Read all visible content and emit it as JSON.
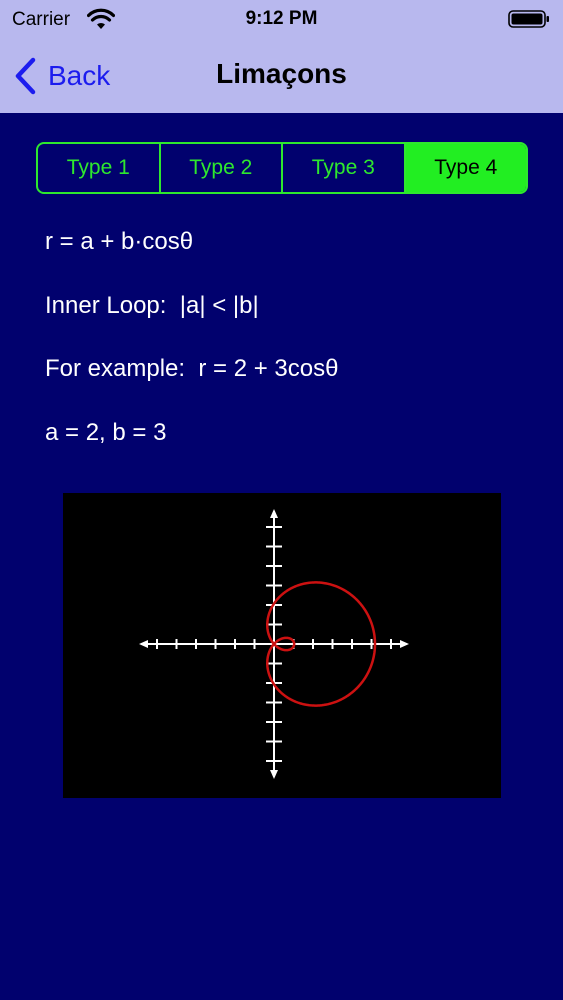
{
  "status_bar": {
    "carrier": "Carrier",
    "time": "9:12 PM"
  },
  "nav": {
    "back_label": "Back",
    "title": "Limaçons"
  },
  "segments": {
    "items": [
      "Type 1",
      "Type 2",
      "Type 3",
      "Type 4"
    ],
    "selected_index": 3
  },
  "content": {
    "formula": "r = a + b·cosθ",
    "condition": "Inner Loop:  |a| < |b|",
    "example": "For example:  r = 2 + 3cosθ",
    "params": "a = 2, b = 3"
  },
  "graph": {
    "a": 2,
    "b": 3,
    "curve_color": "#cc1111",
    "axis_color": "#ffffff",
    "x_range": [
      -6,
      6
    ],
    "y_range": [
      -6,
      6
    ]
  },
  "colors": {
    "background": "#01016e",
    "header": "#b8b8ee",
    "accent_green": "#22ee22",
    "back_blue": "#1c1cee"
  }
}
